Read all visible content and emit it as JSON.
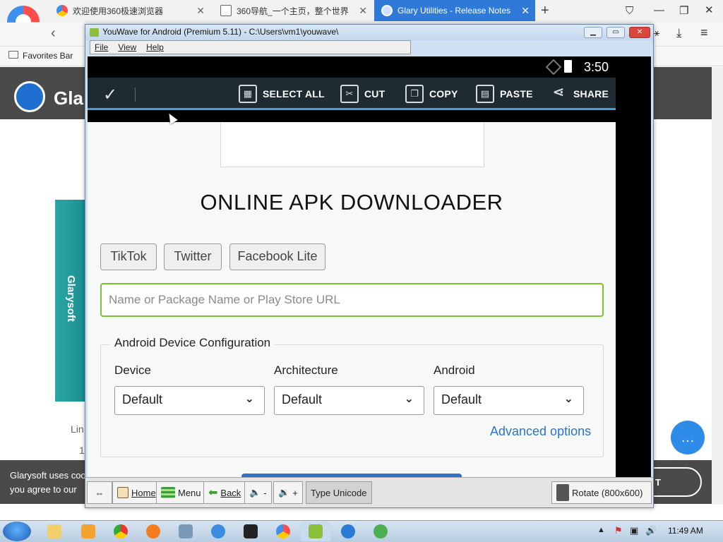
{
  "browser": {
    "tabs": [
      {
        "label": "欢迎使用360极速浏览器",
        "active": false
      },
      {
        "label": "360导航_一个主页，整个世界",
        "active": false
      },
      {
        "label": "Glary Utilities - Release Notes",
        "active": true
      }
    ],
    "new_tab": "+",
    "favorites_bar": "Favorites Bar"
  },
  "background_site": {
    "logo_text": "Gla",
    "box_label": "Glarysoft",
    "side_text_1": "Lin",
    "side_text_2": "1",
    "cookie_line_1": "Glarysoft uses coo",
    "cookie_line_2": "you agree to our",
    "cookie_button": "T"
  },
  "youwave": {
    "title": "YouWave for Android (Premium 5.11) - C:\\Users\\vm1\\youwave\\",
    "menu": [
      "File",
      "View",
      "Help"
    ],
    "status_clock": "3:50",
    "action_bar": {
      "select_all": "SELECT ALL",
      "cut": "CUT",
      "copy": "COPY",
      "paste": "PASTE",
      "share": "SHARE"
    },
    "page": {
      "title": "ONLINE APK DOWNLOADER",
      "chips": [
        "TikTok",
        "Twitter",
        "Facebook Lite"
      ],
      "search_placeholder": "Name or Package Name or Play Store URL",
      "config_legend": "Android Device Configuration",
      "labels": {
        "device": "Device",
        "architecture": "Architecture",
        "android": "Android"
      },
      "selects": {
        "device": "Default",
        "architecture": "Default",
        "android": "Default"
      },
      "advanced_options": "Advanced options"
    },
    "toolbar": {
      "home": "Home",
      "menu": "Menu",
      "back": "Back",
      "minus": "-",
      "plus": "+",
      "type_unicode": "Type Unicode",
      "rotate": "Rotate (800x600)"
    }
  },
  "taskbar": {
    "time": "11:49 AM"
  }
}
